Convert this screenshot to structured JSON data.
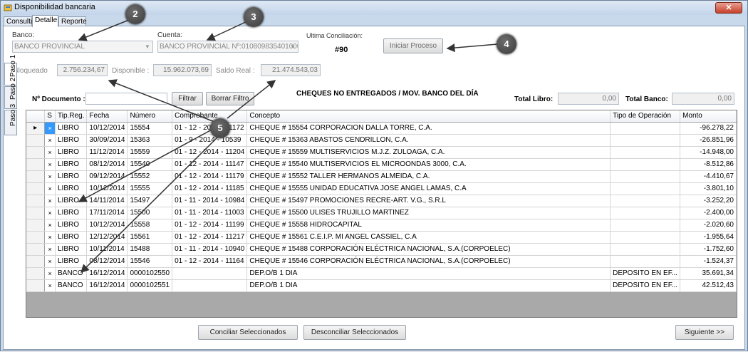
{
  "window": {
    "title": "Disponibilidad bancaria",
    "close_label": "✕"
  },
  "tabs": [
    {
      "label": "Consulta"
    },
    {
      "label": "Detalle"
    },
    {
      "label": "Reporte"
    }
  ],
  "form": {
    "banco_label": "Banco:",
    "banco_value": "BANCO PROVINCIAL",
    "cuenta_label": "Cuenta:",
    "cuenta_value": "BANCO PROVINCIAL Nº:01080983540100000?",
    "ultima_label": "Ultima Conciliación:",
    "ultima_value": "#90",
    "iniciar_label": "Iniciar Proceso",
    "bloqueado_label": "Bloqueado",
    "bloqueado_value": "2.756.234,67",
    "disponible_label": "Disponible :",
    "disponible_value": "15.962.073,69",
    "saldo_label": "Saldo Real :",
    "saldo_value": "21.474.543,03"
  },
  "filter": {
    "documento_label": "Nº Documento :",
    "documento_value": "",
    "filtrar_label": "Filtrar",
    "borrar_label": "Borrar Filtro",
    "section_title": "CHEQUES NO ENTREGADOS / MOV. BANCO DEL DÍA",
    "total_libro_label": "Total Libro:",
    "total_libro_value": "0,00",
    "total_banco_label": "Total Banco:",
    "total_banco_value": "0,00"
  },
  "side_tabs": [
    {
      "label": "Paso 1"
    },
    {
      "label": "Paso 2"
    },
    {
      "label": "Paso 3"
    }
  ],
  "table": {
    "columns": [
      "S",
      "Tip.Reg.",
      "Fecha",
      "Número",
      "Comprobante",
      "Concepto",
      "Tipo de Operación",
      "Monto"
    ],
    "rows": [
      {
        "s": "×",
        "tip": "LIBRO",
        "fecha": "10/12/2014",
        "numero": "15554",
        "comp": "01 - 12 - 2014 - 11172",
        "concepto": "CHEQUE # 15554 CORPORACION DALLA TORRE, C.A.",
        "tipo": "",
        "monto": "-96.278,22"
      },
      {
        "s": "×",
        "tip": "LIBRO",
        "fecha": "30/09/2014",
        "numero": "15363",
        "comp": "01 - 9 - 2014 - 10539",
        "concepto": "CHEQUE # 15363 ABASTOS CENDRILLON, C.A.",
        "tipo": "",
        "monto": "-26.851,96"
      },
      {
        "s": "×",
        "tip": "LIBRO",
        "fecha": "11/12/2014",
        "numero": "15559",
        "comp": "01 - 12 - 2014 - 11204",
        "concepto": "CHEQUE # 15559 MULTISERVICIOS M.J.Z. ZULOAGA, C.A.",
        "tipo": "",
        "monto": "-14.948,00"
      },
      {
        "s": "×",
        "tip": "LIBRO",
        "fecha": "08/12/2014",
        "numero": "15540",
        "comp": "01 - 12 - 2014 - 11147",
        "concepto": "CHEQUE # 15540 MULTISERVICIOS EL MICROONDAS 3000, C.A.",
        "tipo": "",
        "monto": "-8.512,86"
      },
      {
        "s": "×",
        "tip": "LIBRO",
        "fecha": "09/12/2014",
        "numero": "15552",
        "comp": "01 - 12 - 2014 - 11179",
        "concepto": "CHEQUE # 15552 TALLER HERMANOS ALMEIDA, C.A.",
        "tipo": "",
        "monto": "-4.410,67"
      },
      {
        "s": "×",
        "tip": "LIBRO",
        "fecha": "10/12/2014",
        "numero": "15555",
        "comp": "01 - 12 - 2014 - 11185",
        "concepto": "CHEQUE # 15555 UNIDAD EDUCATIVA JOSE ANGEL LAMAS, C.A",
        "tipo": "",
        "monto": "-3.801,10"
      },
      {
        "s": "×",
        "tip": "LIBRO",
        "fecha": "14/11/2014",
        "numero": "15497",
        "comp": "01 - 11 - 2014 - 10984",
        "concepto": "CHEQUE # 15497 PROMOCIONES RECRE-ART. V.G., S.R.L",
        "tipo": "",
        "monto": "-3.252,20"
      },
      {
        "s": "×",
        "tip": "LIBRO",
        "fecha": "17/11/2014",
        "numero": "15500",
        "comp": "01 - 11 - 2014 - 11003",
        "concepto": "CHEQUE # 15500 ULISES TRUJILLO MARTINEZ",
        "tipo": "",
        "monto": "-2.400,00"
      },
      {
        "s": "×",
        "tip": "LIBRO",
        "fecha": "10/12/2014",
        "numero": "15558",
        "comp": "01 - 12 - 2014 - 11199",
        "concepto": "CHEQUE # 15558 HIDROCAPITAL",
        "tipo": "",
        "monto": "-2.020,60"
      },
      {
        "s": "×",
        "tip": "LIBRO",
        "fecha": "12/12/2014",
        "numero": "15561",
        "comp": "01 - 12 - 2014 - 11217",
        "concepto": "CHEQUE # 15561 C.E.I.P. MI ANGEL CASSIEL, C.A",
        "tipo": "",
        "monto": "-1.955,64"
      },
      {
        "s": "×",
        "tip": "LIBRO",
        "fecha": "10/11/2014",
        "numero": "15488",
        "comp": "01 - 11 - 2014 - 10940",
        "concepto": "CHEQUE # 15488 CORPORACIÓN ELÉCTRICA NACIONAL, S.A.(CORPOELEC)",
        "tipo": "",
        "monto": "-1.752,60"
      },
      {
        "s": "×",
        "tip": "LIBRO",
        "fecha": "08/12/2014",
        "numero": "15546",
        "comp": "01 - 12 - 2014 - 11164",
        "concepto": "CHEQUE # 15546 CORPORACIÓN ELÉCTRICA NACIONAL, S.A.(CORPOELEC)",
        "tipo": "",
        "monto": "-1.524,37"
      },
      {
        "s": "×",
        "tip": "BANCO",
        "fecha": "16/12/2014",
        "numero": "0000102550",
        "comp": "",
        "concepto": "DEP.O/B 1 DIA",
        "tipo": "DEPOSITO EN EF...",
        "monto": "35.691,34"
      },
      {
        "s": "×",
        "tip": "BANCO",
        "fecha": "16/12/2014",
        "numero": "0000102551",
        "comp": "",
        "concepto": "DEP.O/B 1 DIA",
        "tipo": "DEPOSITO EN EF...",
        "monto": "42.512,43"
      }
    ]
  },
  "footer": {
    "conciliar_label": "Conciliar Seleccionados",
    "desconciliar_label": "Desconciliar Seleccionados",
    "siguiente_label": "Siguiente >>"
  },
  "annotations": [
    "2",
    "3",
    "4",
    "5"
  ],
  "icons": {
    "app": "app-icon",
    "row_pointer": "row-pointer-icon",
    "dropdown": "chevron-down-icon"
  },
  "colors": {
    "selection": "#3399ff",
    "grid_bg": "#a9a9a9",
    "window": "#c9d9ec"
  }
}
